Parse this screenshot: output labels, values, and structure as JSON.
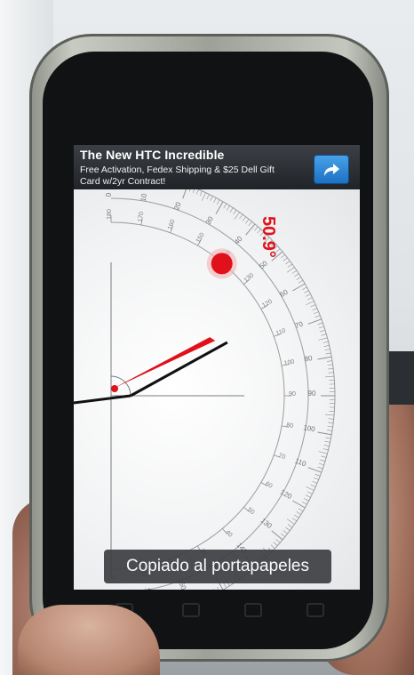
{
  "ad": {
    "title": "The New HTC Incredible",
    "line1": "Free Activation, Fedex Shipping & $25 Dell Gift",
    "line2": "Card w/2yr Contract!",
    "share_icon": "share-arrow-icon"
  },
  "angle_readout": "50.9°",
  "measured_angle_deg": 50.9,
  "toast": "Copiado al portapapeles",
  "colors": {
    "accent_red": "#e0111a",
    "ad_button_blue": "#2f86d6",
    "toast_bg": "#3c3e42"
  },
  "scale_labels": {
    "outer": [
      "0",
      "10",
      "20",
      "30",
      "40",
      "50",
      "60",
      "70",
      "80",
      "90",
      "100",
      "110",
      "120",
      "130",
      "140",
      "150",
      "160",
      "170",
      "180"
    ],
    "inner": [
      "180",
      "170",
      "160",
      "150",
      "140",
      "130",
      "120",
      "110",
      "100",
      "90",
      "80",
      "70",
      "60",
      "50",
      "40",
      "30",
      "20",
      "10",
      "0"
    ]
  }
}
